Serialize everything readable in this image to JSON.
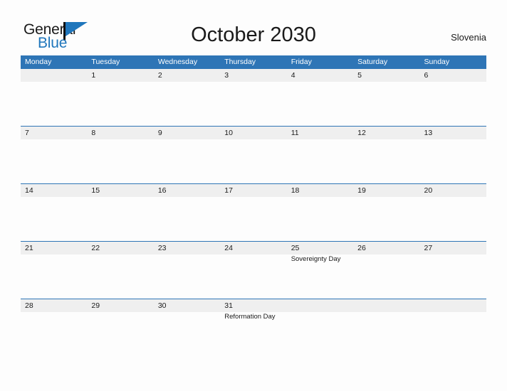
{
  "brand": {
    "name_part1": "General",
    "name_part2": "Blue",
    "color_dark": "#1A1A1A",
    "color_blue": "#1F76BC"
  },
  "header": {
    "title": "October 2030",
    "country": "Slovenia"
  },
  "theme": {
    "header_blue": "#2E75B6",
    "band_gray": "#EFEFEF",
    "page_bg": "#FDFDFD",
    "text": "#1A1A1A"
  },
  "calendar": {
    "month": "October",
    "year": "2030",
    "weekday_headers": [
      "Monday",
      "Tuesday",
      "Wednesday",
      "Thursday",
      "Friday",
      "Saturday",
      "Sunday"
    ],
    "weeks": [
      [
        {
          "day": "",
          "event": ""
        },
        {
          "day": "1",
          "event": ""
        },
        {
          "day": "2",
          "event": ""
        },
        {
          "day": "3",
          "event": ""
        },
        {
          "day": "4",
          "event": ""
        },
        {
          "day": "5",
          "event": ""
        },
        {
          "day": "6",
          "event": ""
        }
      ],
      [
        {
          "day": "7",
          "event": ""
        },
        {
          "day": "8",
          "event": ""
        },
        {
          "day": "9",
          "event": ""
        },
        {
          "day": "10",
          "event": ""
        },
        {
          "day": "11",
          "event": ""
        },
        {
          "day": "12",
          "event": ""
        },
        {
          "day": "13",
          "event": ""
        }
      ],
      [
        {
          "day": "14",
          "event": ""
        },
        {
          "day": "15",
          "event": ""
        },
        {
          "day": "16",
          "event": ""
        },
        {
          "day": "17",
          "event": ""
        },
        {
          "day": "18",
          "event": ""
        },
        {
          "day": "19",
          "event": ""
        },
        {
          "day": "20",
          "event": ""
        }
      ],
      [
        {
          "day": "21",
          "event": ""
        },
        {
          "day": "22",
          "event": ""
        },
        {
          "day": "23",
          "event": ""
        },
        {
          "day": "24",
          "event": ""
        },
        {
          "day": "25",
          "event": "Sovereignty Day"
        },
        {
          "day": "26",
          "event": ""
        },
        {
          "day": "27",
          "event": ""
        }
      ],
      [
        {
          "day": "28",
          "event": ""
        },
        {
          "day": "29",
          "event": ""
        },
        {
          "day": "30",
          "event": ""
        },
        {
          "day": "31",
          "event": "Reformation Day"
        },
        {
          "day": "",
          "event": ""
        },
        {
          "day": "",
          "event": ""
        },
        {
          "day": "",
          "event": ""
        }
      ]
    ]
  }
}
